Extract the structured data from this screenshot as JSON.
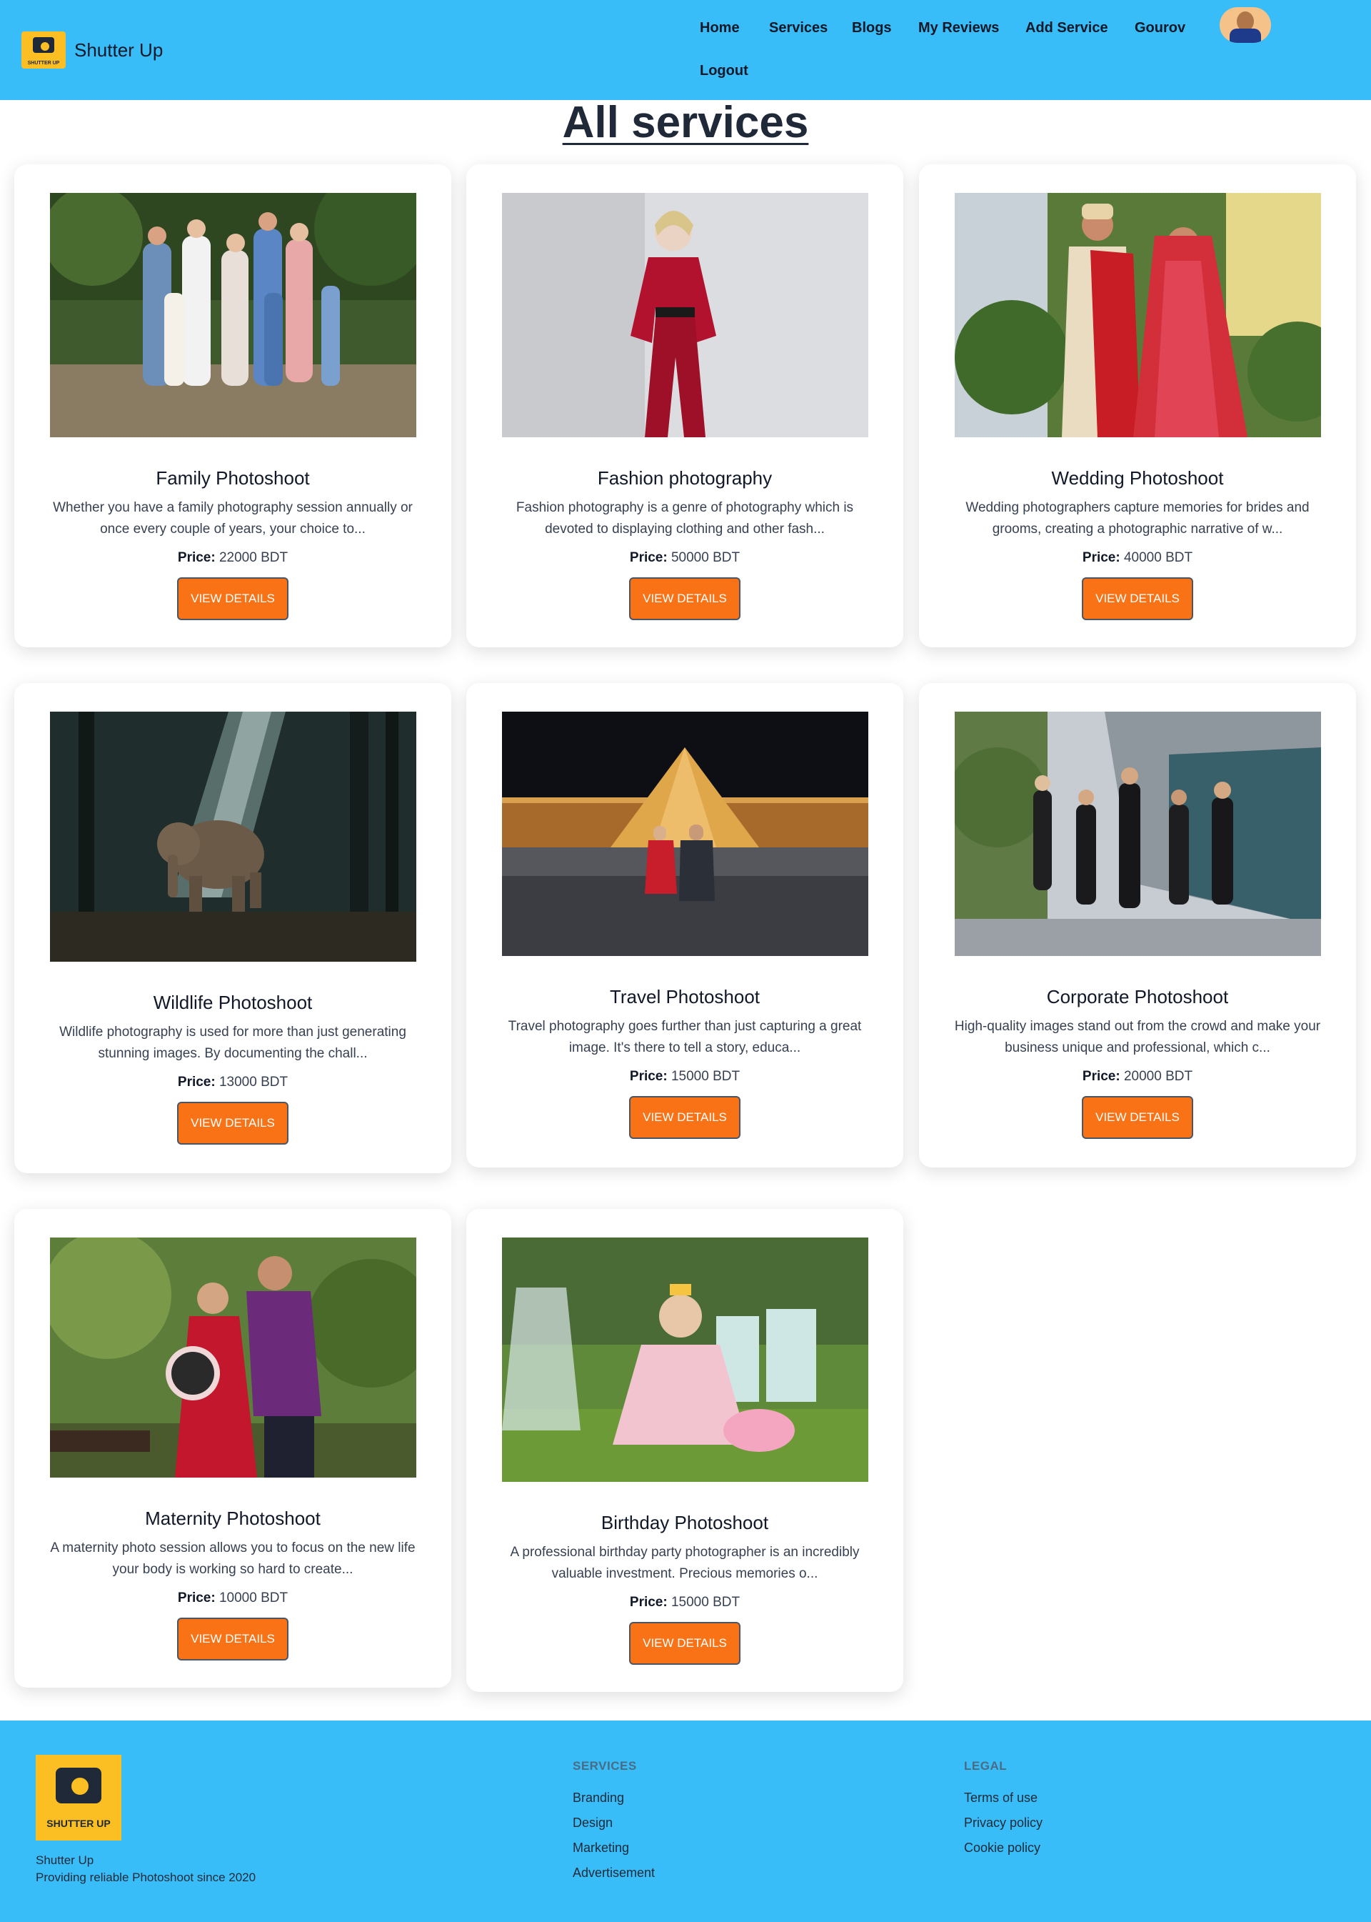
{
  "header": {
    "brand_name": "Shutter Up",
    "logo_text": "SHUTTER UP",
    "nav": [
      "Home",
      "Services",
      "Blogs",
      "My Reviews",
      "Add Service",
      "Gourov",
      "Logout"
    ]
  },
  "main": {
    "title": "All services",
    "price_label": "Price:",
    "button_label": "VIEW DETAILS",
    "services": [
      {
        "title": "Family Photoshoot",
        "desc": "Whether you have a family photography session annually or once every couple of years, your choice to...",
        "price": "22000 BDT"
      },
      {
        "title": "Fashion photography",
        "desc": "Fashion photography is a genre of photography which is devoted to displaying clothing and other fash...",
        "price": "50000 BDT"
      },
      {
        "title": "Wedding Photoshoot",
        "desc": "Wedding photographers capture memories for brides and grooms, creating a photographic narrative of w...",
        "price": "40000 BDT"
      },
      {
        "title": "Wildlife Photoshoot",
        "desc": "Wildlife photography is used for more than just generating stunning images. By documenting the chall...",
        "price": "13000 BDT"
      },
      {
        "title": "Travel Photoshoot",
        "desc": "Travel photography goes further than just capturing a great image. It's there to tell a story, educa...",
        "price": "15000 BDT"
      },
      {
        "title": "Corporate Photoshoot",
        "desc": "High-quality images stand out from the crowd and make your business unique and professional, which c...",
        "price": "20000 BDT"
      },
      {
        "title": "Maternity Photoshoot",
        "desc": "A maternity photo session allows you to focus on the new life your body is working so hard to create...",
        "price": "10000 BDT"
      },
      {
        "title": "Birthday Photoshoot",
        "desc": "A professional birthday party photographer is an incredibly valuable investment. Precious memories o...",
        "price": "15000 BDT"
      }
    ]
  },
  "footer": {
    "logo_text": "SHUTTER UP",
    "name": "Shutter Up",
    "tagline": "Providing reliable Photoshoot since 2020",
    "services_heading": "SERVICES",
    "services_links": [
      "Branding",
      "Design",
      "Marketing",
      "Advertisement"
    ],
    "legal_heading": "LEGAL",
    "legal_links": [
      "Terms of use",
      "Privacy policy",
      "Cookie policy"
    ]
  },
  "colors": {
    "header_bg": "#38bdf8",
    "button_bg": "#f97316",
    "logo_bg": "#fbbf24"
  },
  "icons": [
    "camera-logo-icon",
    "user-avatar"
  ]
}
